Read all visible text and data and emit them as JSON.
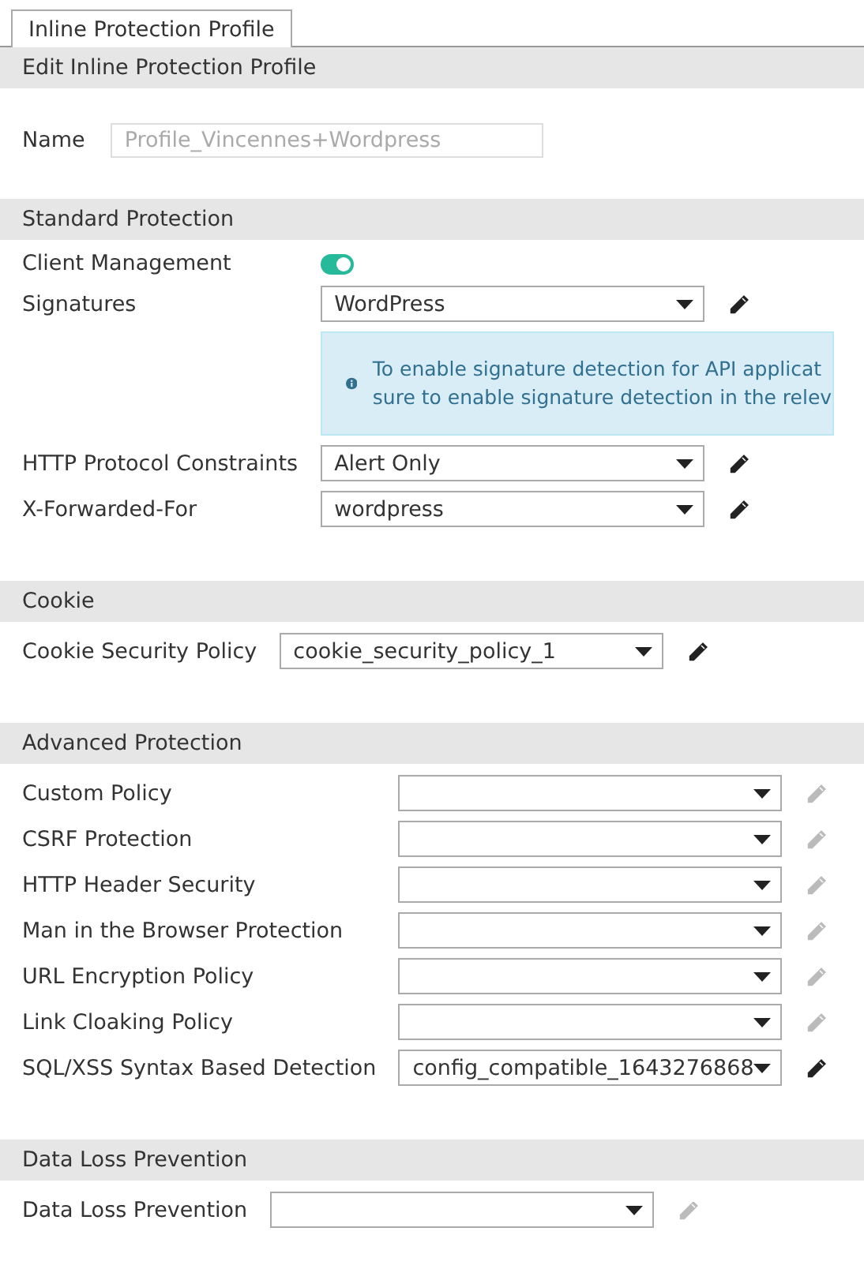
{
  "tabs": [
    {
      "label": "Inline Protection Profile",
      "selected": true
    }
  ],
  "header": {
    "title": "Edit Inline Protection Profile"
  },
  "name_field": {
    "label": "Name",
    "value": "Profile_Vincennes+Wordpress",
    "disabled": true
  },
  "sections": [
    {
      "title": "Standard Protection",
      "rows": [
        {
          "kind": "toggle",
          "label": "Client Management",
          "on": true
        },
        {
          "kind": "select",
          "label": "Signatures",
          "value": "WordPress",
          "editable": true,
          "info_lines": [
            "To enable signature detection for API applicat",
            "sure to enable signature detection in the relev"
          ]
        },
        {
          "kind": "select",
          "label": "HTTP Protocol Constraints",
          "value": "Alert Only",
          "editable": true
        },
        {
          "kind": "select",
          "label": "X-Forwarded-For",
          "value": "wordpress",
          "editable": true
        }
      ]
    },
    {
      "title": "Cookie",
      "rows": [
        {
          "kind": "select",
          "label": "Cookie Security Policy",
          "value": "cookie_security_policy_1",
          "editable": true
        }
      ]
    },
    {
      "title": "Advanced Protection",
      "rows": [
        {
          "kind": "select",
          "label": "Custom Policy",
          "editable": false
        },
        {
          "kind": "select",
          "label": "CSRF Protection",
          "editable": false
        },
        {
          "kind": "select",
          "label": "HTTP Header Security",
          "editable": false
        },
        {
          "kind": "select",
          "label": "Man in the Browser Protection",
          "editable": false
        },
        {
          "kind": "select",
          "label": "URL Encryption Policy",
          "editable": false
        },
        {
          "kind": "select",
          "label": "Link Cloaking Policy",
          "editable": false
        },
        {
          "kind": "select",
          "label": "SQL/XSS Syntax Based Detection",
          "value": "config_compatible_1643276868",
          "editable": true
        }
      ]
    },
    {
      "title": "Data Loss Prevention",
      "rows": [
        {
          "kind": "select",
          "label": "Data Loss Prevention",
          "editable": false
        }
      ]
    }
  ]
}
